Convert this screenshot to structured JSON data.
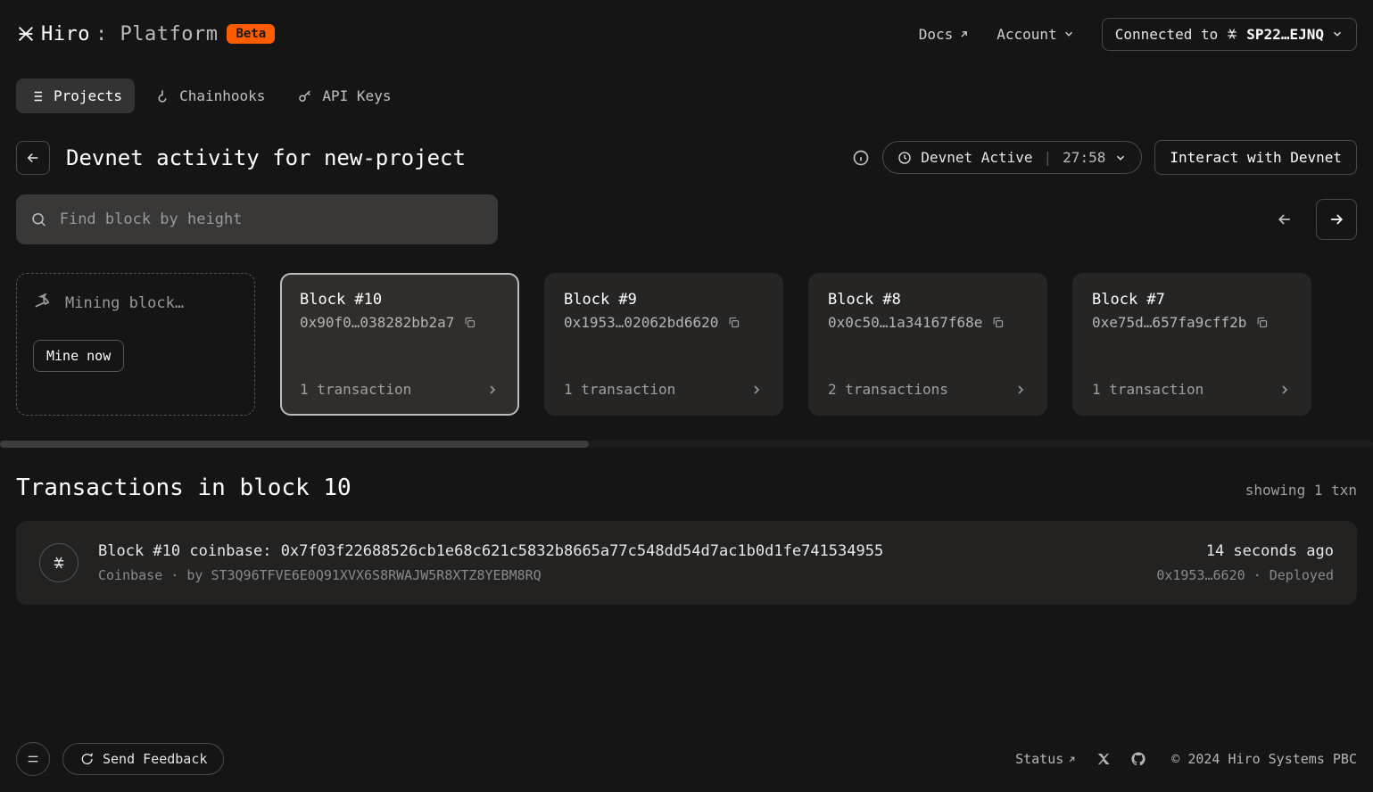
{
  "header": {
    "logo_main": "Hiro",
    "logo_sub": ": Platform",
    "beta": "Beta",
    "docs": "Docs",
    "account": "Account",
    "connected_prefix": "Connected to",
    "wallet_short": "SP22…EJNQ"
  },
  "nav": {
    "projects": "Projects",
    "chainhooks": "Chainhooks",
    "api_keys": "API Keys"
  },
  "page": {
    "title": "Devnet activity for new-project",
    "devnet_status_label": "Devnet Active",
    "devnet_timer": "27:58",
    "interact": "Interact with Devnet",
    "search_placeholder": "Find block by height"
  },
  "mining": {
    "label": "Mining block…",
    "button": "Mine now"
  },
  "blocks": [
    {
      "label": "Block #10",
      "hash": "0x90f0…038282bb2a7",
      "txs": "1 transaction"
    },
    {
      "label": "Block #9",
      "hash": "0x1953…02062bd6620",
      "txs": "1 transaction"
    },
    {
      "label": "Block #8",
      "hash": "0x0c50…1a34167f68e",
      "txs": "2 transactions"
    },
    {
      "label": "Block #7",
      "hash": "0xe75d…657fa9cff2b",
      "txs": "1 transaction"
    }
  ],
  "txs": {
    "heading": "Transactions in block 10",
    "showing": "showing 1 txn",
    "items": [
      {
        "title": "Block #10 coinbase: 0x7f03f22688526cb1e68c621c5832b8665a77c548dd54d7ac1b0d1fe741534955",
        "type": "Coinbase",
        "by_prefix": "by",
        "by": "ST3Q96TFVE6E0Q91XVX6S8RWAJW5R8XTZ8YEBM8RQ",
        "time": "14 seconds ago",
        "hash_short": "0x1953…6620",
        "status": "Deployed"
      }
    ]
  },
  "footer": {
    "feedback": "Send Feedback",
    "status": "Status",
    "copyright": "© 2024 Hiro Systems PBC"
  }
}
